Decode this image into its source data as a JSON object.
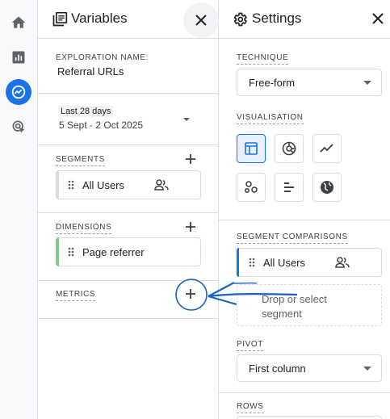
{
  "nav": {
    "items": [
      {
        "name": "home",
        "icon": "home-icon",
        "active": false
      },
      {
        "name": "reports",
        "icon": "bar-chart-icon",
        "active": false
      },
      {
        "name": "explore",
        "icon": "explore-icon",
        "active": true
      },
      {
        "name": "advertising",
        "icon": "cursor-target-icon",
        "active": false
      }
    ]
  },
  "variables": {
    "title": "Variables",
    "exploration_name_label": "EXPLORATION NAME:",
    "exploration_name": "Referral URLs",
    "date_badge": "Last 28 days",
    "date_range": "5 Sept - 2 Oct 2025",
    "segments_label": "SEGMENTS",
    "segment_item": "All Users",
    "dimensions_label": "DIMENSIONS",
    "dimension_item": "Page referrer",
    "metrics_label": "METRICS"
  },
  "settings": {
    "title": "Settings",
    "technique_label": "TECHNIQUE",
    "technique_value": "Free-form",
    "visualisation_label": "VISUALISATION",
    "viz_options": [
      "table-icon",
      "donut-chart-icon",
      "line-chart-icon",
      "scatter-plot-icon",
      "bar-chart-horizontal-icon",
      "geo-map-icon"
    ],
    "segment_comparisons_label": "SEGMENT COMPARISONS",
    "comparison_item": "All Users",
    "drop_text": "Drop or select segment",
    "pivot_label": "PIVOT",
    "pivot_value": "First column",
    "rows_label": "ROWS"
  },
  "colors": {
    "accent": "#1a73e8",
    "dimension_bar": "#81c995",
    "annotation": "#1565c0"
  }
}
